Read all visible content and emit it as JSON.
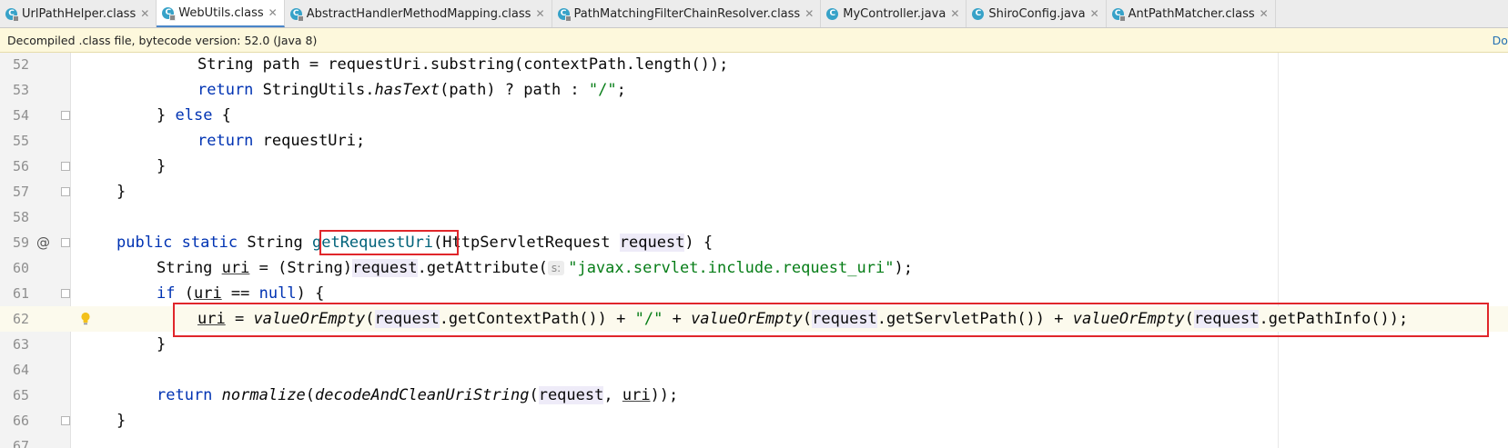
{
  "tabs": [
    {
      "label": "UrlPathHelper.class",
      "icon": "class-file-icon",
      "active": false
    },
    {
      "label": "WebUtils.class",
      "icon": "class-file-icon",
      "active": true
    },
    {
      "label": "AbstractHandlerMethodMapping.class",
      "icon": "class-file-icon",
      "active": false
    },
    {
      "label": "PathMatchingFilterChainResolver.class",
      "icon": "class-file-icon",
      "active": false
    },
    {
      "label": "MyController.java",
      "icon": "java-class-icon",
      "active": false
    },
    {
      "label": "ShiroConfig.java",
      "icon": "java-class-icon",
      "active": false
    },
    {
      "label": "AntPathMatcher.class",
      "icon": "class-file-icon",
      "active": false
    }
  ],
  "banner": {
    "text": "Decompiled .class file, bytecode version: 52.0 (Java 8)",
    "link": "Down"
  },
  "editor": {
    "line_numbers": [
      "52",
      "53",
      "54",
      "55",
      "56",
      "57",
      "58",
      "59",
      "60",
      "61",
      "62",
      "63",
      "64",
      "65",
      "66",
      "67"
    ],
    "highlight_color": "#e0262b",
    "caret_line": "62"
  },
  "code": {
    "l52": {
      "a": "String path = requestUri.substring(contextPath.length());"
    },
    "l53": {
      "kw": "return",
      "a": " StringUtils.",
      "b": "hasText",
      "c": "(path) ? path : ",
      "d": "\"/\"",
      "e": ";"
    },
    "l54": {
      "a": "} ",
      "kw": "else",
      "b": " {"
    },
    "l55": {
      "kw": "return",
      "a": " requestUri;"
    },
    "l56": {
      "a": "}"
    },
    "l57": {
      "a": "}"
    },
    "l59": {
      "kw1": "public",
      "kw2": "static",
      "a": " String ",
      "method": "getRequestUri",
      "b": "(HttpServletRequest ",
      "param": "request",
      "c": ") {"
    },
    "l60": {
      "a": "String ",
      "var": "uri",
      "b": " = (String)",
      "req": "request",
      "c": ".getAttribute(",
      "hint": "s:",
      "str": "\"javax.servlet.include.request_uri\"",
      "d": ");"
    },
    "l61": {
      "kw": "if",
      "a": " (",
      "var": "uri",
      "b": " == ",
      "kw2": "null",
      "c": ") {"
    },
    "l62": {
      "var": "uri",
      "a": " = ",
      "f1": "valueOrEmpty",
      "b": "(",
      "req1a": "reques",
      "req1b": "t",
      "c": ".getContextPath()) + ",
      "str": "\"/\"",
      "d": " + ",
      "f2": "valueOrEmpty",
      "e": "(",
      "req2": "request",
      "g": ".getServletPath()) + ",
      "f3": "valueOrEmpty",
      "h": "(",
      "req3": "request",
      "i": ".getPathInfo());"
    },
    "l63": {
      "a": "}"
    },
    "l65": {
      "kw": "return",
      "f1": "normalize",
      "a": "(",
      "f2": "decodeAndCleanUriString",
      "b": "(",
      "req": "request",
      "c": ", ",
      "var": "uri",
      "d": "));"
    },
    "l66": {
      "a": "}"
    }
  }
}
